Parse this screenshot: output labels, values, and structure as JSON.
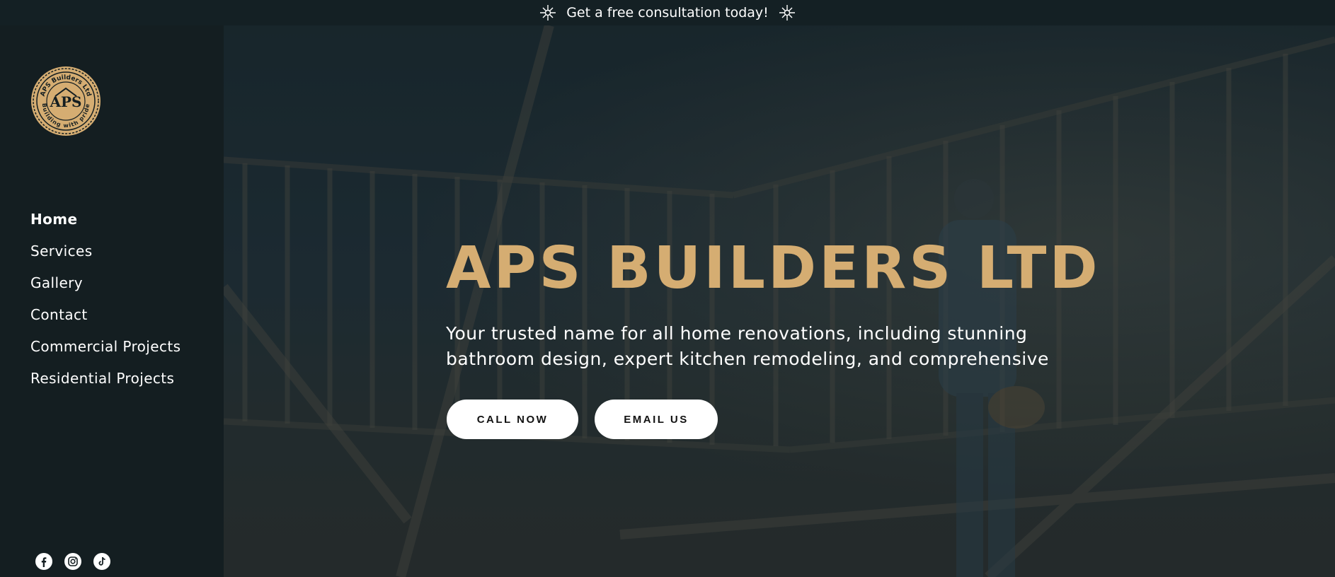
{
  "announcement": {
    "text": "Get a free consultation today!",
    "icon": "sparkle-icon"
  },
  "sidebar": {
    "logo": {
      "text_top": "APS Builders Ltd",
      "text_bottom": "Building with pride",
      "monogram": "APS"
    },
    "nav": [
      {
        "label": "Home",
        "active": true
      },
      {
        "label": "Services",
        "active": false
      },
      {
        "label": "Gallery",
        "active": false
      },
      {
        "label": "Contact",
        "active": false
      },
      {
        "label": "Commercial Projects",
        "active": false
      },
      {
        "label": "Residential Projects",
        "active": false
      }
    ],
    "socials": [
      "facebook-icon",
      "instagram-icon",
      "tiktok-icon"
    ]
  },
  "hero": {
    "title": "APS BUILDERS LTD",
    "subtitle": "Your trusted name for all home renovations, including stunning bathroom design, expert kitchen remodeling, and comprehensive",
    "call_label": "CALL NOW",
    "email_label": "EMAIL US"
  },
  "colors": {
    "accent": "#d5ad72",
    "background": "#141e21",
    "button": "#ffffff"
  }
}
